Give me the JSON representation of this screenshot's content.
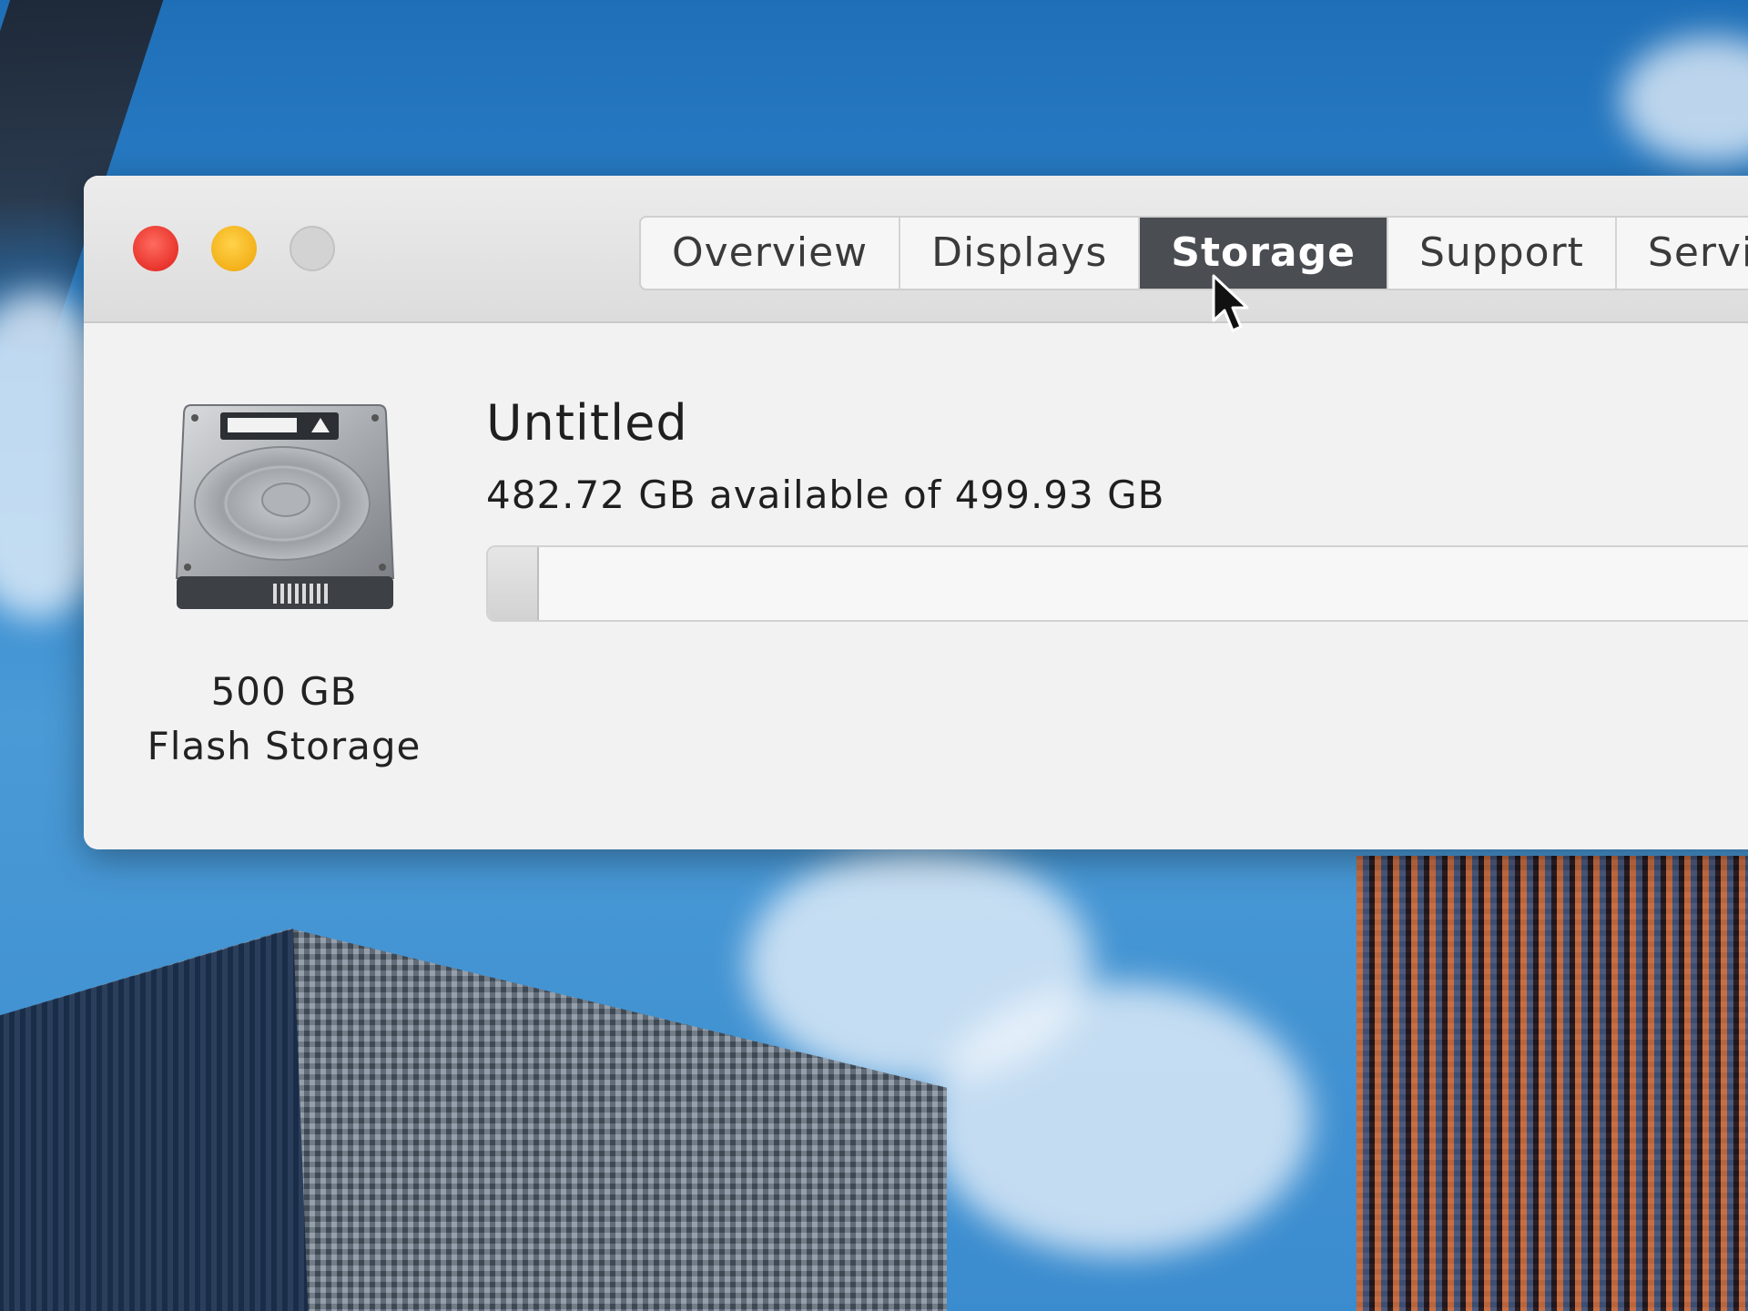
{
  "window": {
    "title_buttons": [
      "close",
      "minimize",
      "zoom"
    ],
    "colors": {
      "close": "#e8342c",
      "minimize": "#f3b11a",
      "zoom_disabled": "#d3d3d3",
      "active_tab": "#4a4d52"
    }
  },
  "tabs": [
    {
      "label": "Overview",
      "active": false
    },
    {
      "label": "Displays",
      "active": false
    },
    {
      "label": "Storage",
      "active": true
    },
    {
      "label": "Support",
      "active": false
    },
    {
      "label": "Servic",
      "active": false
    }
  ],
  "drive": {
    "icon": "hard-drive-icon",
    "size": "500 GB",
    "type": "Flash Storage"
  },
  "volume": {
    "name": "Untitled",
    "availability": "482.72 GB available of 499.93 GB",
    "available_gb": 482.72,
    "total_gb": 499.93,
    "used_fraction": 0.0344
  },
  "cursor": {
    "icon": "arrow-pointer-icon"
  }
}
